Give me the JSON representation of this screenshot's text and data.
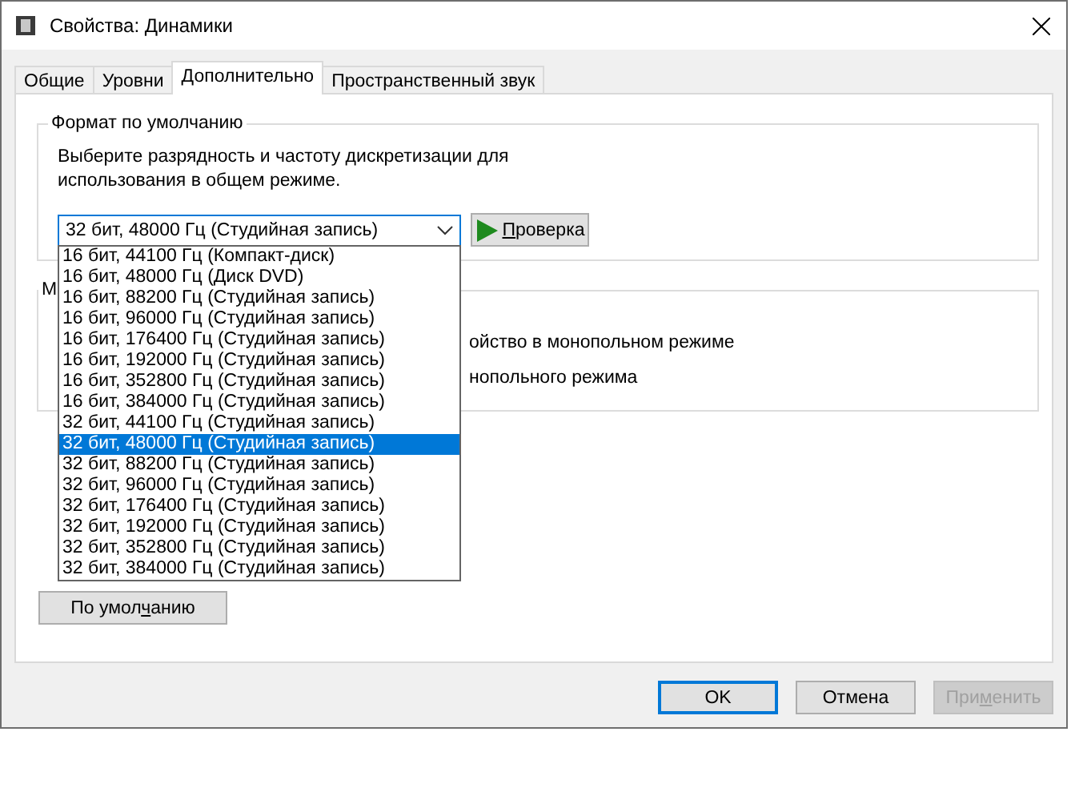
{
  "window": {
    "title": "Свойства: Динамики"
  },
  "tabs": [
    {
      "label": "Общие",
      "selected": false
    },
    {
      "label": "Уровни",
      "selected": false
    },
    {
      "label": "Дополнительно",
      "selected": true
    },
    {
      "label": "Пространственный звук",
      "selected": false
    }
  ],
  "default_format": {
    "legend": "Формат по умолчанию",
    "description": "Выберите разрядность и частоту дискретизации для использования в общем режиме.",
    "format_value": "32 бит, 48000 Гц (Студийная запись)",
    "test_button": {
      "access_key": "П",
      "text_after": "роверка"
    },
    "options": [
      {
        "label": "16 бит, 44100 Гц (Компакт-диск)",
        "selected": false
      },
      {
        "label": "16 бит, 48000 Гц (Диск DVD)",
        "selected": false
      },
      {
        "label": "16 бит, 88200 Гц (Студийная запись)",
        "selected": false
      },
      {
        "label": "16 бит, 96000 Гц (Студийная запись)",
        "selected": false
      },
      {
        "label": "16 бит, 176400 Гц (Студийная запись)",
        "selected": false
      },
      {
        "label": "16 бит, 192000 Гц (Студийная запись)",
        "selected": false
      },
      {
        "label": "16 бит, 352800 Гц (Студийная запись)",
        "selected": false
      },
      {
        "label": "16 бит, 384000 Гц (Студийная запись)",
        "selected": false
      },
      {
        "label": "32 бит, 44100 Гц (Студийная запись)",
        "selected": false
      },
      {
        "label": "32 бит, 48000 Гц (Студийная запись)",
        "selected": true
      },
      {
        "label": "32 бит, 88200 Гц (Студийная запись)",
        "selected": false
      },
      {
        "label": "32 бит, 96000 Гц (Студийная запись)",
        "selected": false
      },
      {
        "label": "32 бит, 176400 Гц (Студийная запись)",
        "selected": false
      },
      {
        "label": "32 бит, 192000 Гц (Студийная запись)",
        "selected": false
      },
      {
        "label": "32 бит, 352800 Гц (Студийная запись)",
        "selected": false
      },
      {
        "label": "32 бит, 384000 Гц (Студийная запись)",
        "selected": false
      }
    ]
  },
  "exclusive_mode": {
    "legend": "М",
    "lines": [
      "ойство в монопольном режиме",
      "нопольного режима"
    ]
  },
  "restore_button": {
    "text_before": "По умол",
    "access_key": "ч",
    "text_after": "анию"
  },
  "buttons": [
    {
      "text_before": "OK",
      "default": true,
      "disabled": false
    },
    {
      "text_before": "Отмена",
      "default": false,
      "disabled": false
    },
    {
      "text_before": "При",
      "access_key": "м",
      "text_after": "енить",
      "default": false,
      "disabled": true
    }
  ]
}
